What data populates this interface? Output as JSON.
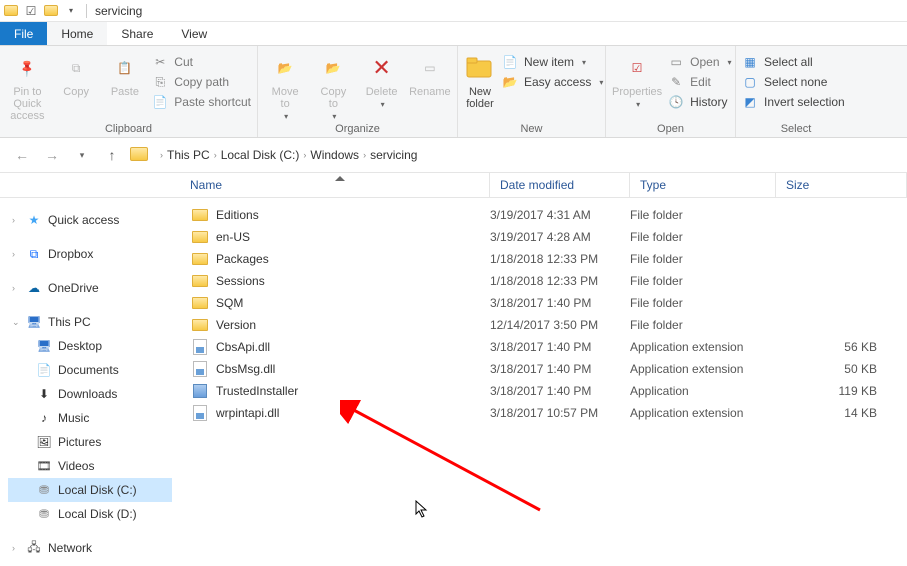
{
  "title": "servicing",
  "tabs": {
    "file": "File",
    "home": "Home",
    "share": "Share",
    "view": "View"
  },
  "ribbon": {
    "clipboard": {
      "label": "Clipboard",
      "pin": "Pin to Quick\naccess",
      "copy": "Copy",
      "paste": "Paste",
      "cut": "Cut",
      "copypath": "Copy path",
      "pasteshortcut": "Paste shortcut"
    },
    "organize": {
      "label": "Organize",
      "moveto": "Move\nto",
      "copyto": "Copy\nto",
      "delete": "Delete",
      "rename": "Rename"
    },
    "new": {
      "label": "New",
      "newfolder": "New\nfolder",
      "newitem": "New item",
      "easyaccess": "Easy access"
    },
    "open": {
      "label": "Open",
      "properties": "Properties",
      "open": "Open",
      "edit": "Edit",
      "history": "History"
    },
    "select": {
      "label": "Select",
      "selectall": "Select all",
      "selectnone": "Select none",
      "invert": "Invert selection"
    }
  },
  "breadcrumbs": [
    "This PC",
    "Local Disk (C:)",
    "Windows",
    "servicing"
  ],
  "columns": {
    "name": "Name",
    "date": "Date modified",
    "type": "Type",
    "size": "Size"
  },
  "nav": {
    "quick": "Quick access",
    "dropbox": "Dropbox",
    "onedrive": "OneDrive",
    "thispc": "This PC",
    "desktop": "Desktop",
    "documents": "Documents",
    "downloads": "Downloads",
    "music": "Music",
    "pictures": "Pictures",
    "videos": "Videos",
    "diskc": "Local Disk (C:)",
    "diskd": "Local Disk (D:)",
    "network": "Network"
  },
  "files": [
    {
      "name": "Editions",
      "date": "3/19/2017 4:31 AM",
      "type": "File folder",
      "size": "",
      "icon": "folder"
    },
    {
      "name": "en-US",
      "date": "3/19/2017 4:28 AM",
      "type": "File folder",
      "size": "",
      "icon": "folder"
    },
    {
      "name": "Packages",
      "date": "1/18/2018 12:33 PM",
      "type": "File folder",
      "size": "",
      "icon": "folder"
    },
    {
      "name": "Sessions",
      "date": "1/18/2018 12:33 PM",
      "type": "File folder",
      "size": "",
      "icon": "folder"
    },
    {
      "name": "SQM",
      "date": "3/18/2017 1:40 PM",
      "type": "File folder",
      "size": "",
      "icon": "folder"
    },
    {
      "name": "Version",
      "date": "12/14/2017 3:50 PM",
      "type": "File folder",
      "size": "",
      "icon": "folder"
    },
    {
      "name": "CbsApi.dll",
      "date": "3/18/2017 1:40 PM",
      "type": "Application extension",
      "size": "56 KB",
      "icon": "dll"
    },
    {
      "name": "CbsMsg.dll",
      "date": "3/18/2017 1:40 PM",
      "type": "Application extension",
      "size": "50 KB",
      "icon": "dll"
    },
    {
      "name": "TrustedInstaller",
      "date": "3/18/2017 1:40 PM",
      "type": "Application",
      "size": "119 KB",
      "icon": "exe"
    },
    {
      "name": "wrpintapi.dll",
      "date": "3/18/2017 10:57 PM",
      "type": "Application extension",
      "size": "14 KB",
      "icon": "dll"
    }
  ]
}
